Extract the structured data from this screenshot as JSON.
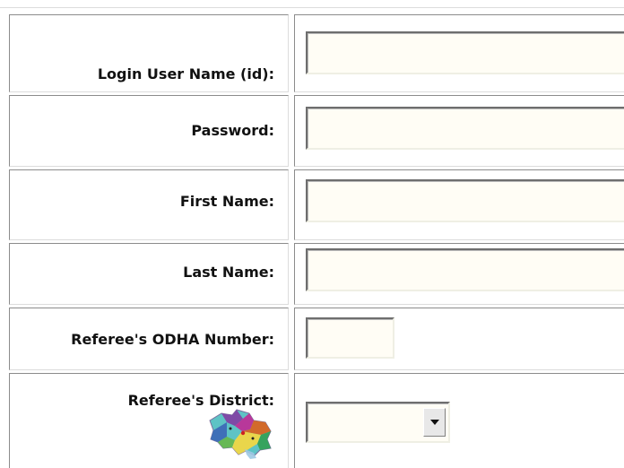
{
  "form": {
    "rows": [
      {
        "label": "Login User Name (id):",
        "field_value": "",
        "field_type": "text"
      },
      {
        "label": "Password:",
        "field_value": "",
        "field_type": "password"
      },
      {
        "label": "First Name:",
        "field_value": "",
        "field_type": "text"
      },
      {
        "label": "Last Name:",
        "field_value": "",
        "field_type": "text"
      },
      {
        "label": "Referee's ODHA Number:",
        "field_value": "",
        "field_type": "text"
      },
      {
        "label": "Referee's District:",
        "selected_value": "",
        "field_type": "select",
        "icon": "district-map-icon"
      }
    ]
  },
  "colors": {
    "field_background": "#fffdf5",
    "cell_border_dark": "#8c8c8c",
    "cell_border_light": "#dcdcdc",
    "label_text": "#111111"
  }
}
